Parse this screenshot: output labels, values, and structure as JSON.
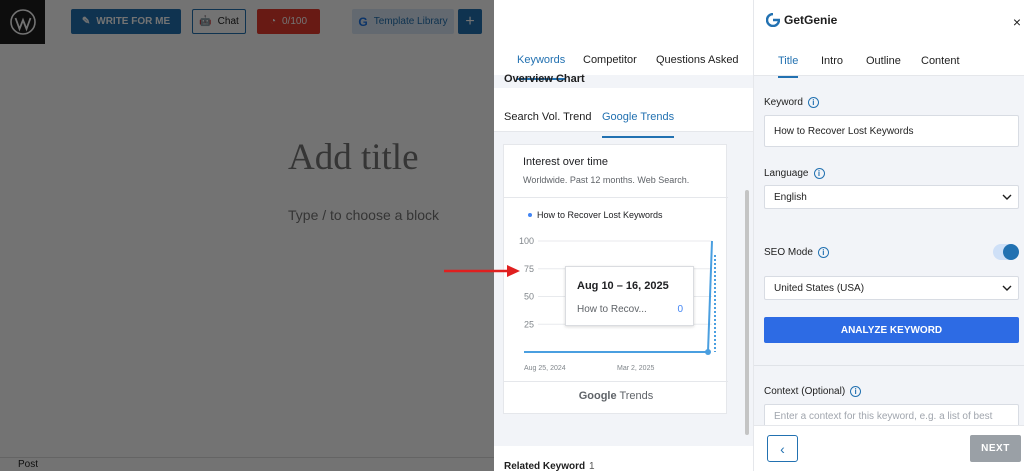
{
  "toolbar": {
    "write_label": "WRITE FOR ME",
    "chat_label": "Chat",
    "usage_label": "0/100",
    "template_label": "Template Library",
    "plus_label": "+"
  },
  "editor": {
    "title_placeholder": "Add title",
    "block_placeholder": "Type / to choose a block",
    "footer_label": "Post"
  },
  "middle": {
    "tabs": [
      {
        "label": "Keywords",
        "active": true
      },
      {
        "label": "Competitor",
        "active": false
      },
      {
        "label": "Questions Asked",
        "active": false
      }
    ],
    "overview_label": "Overview Chart",
    "sub_tabs": [
      {
        "label": "Search Vol. Trend",
        "active": false
      },
      {
        "label": "Google Trends",
        "active": true
      }
    ],
    "trends": {
      "title": "Interest over time",
      "subtitle": "Worldwide. Past 12 months. Web Search.",
      "legend": "How to Recover Lost Keywords",
      "footer_google": "Google",
      "footer_trends": "Trends",
      "tooltip": {
        "date": "Aug 10 – 16, 2025",
        "label": "How to Recov...",
        "value": "0"
      }
    },
    "related_label": "Related Keyword",
    "related_count": "1"
  },
  "chart_data": {
    "type": "line",
    "title": "Interest over time",
    "subtitle": "Worldwide. Past 12 months. Web Search.",
    "x_tick_labels": [
      "Aug 25, 2024",
      "Mar 2, 2025"
    ],
    "y_ticks": [
      25,
      50,
      75,
      100
    ],
    "ylim": [
      0,
      100
    ],
    "series": [
      {
        "name": "How to Recover Lost Keywords",
        "x": [
          "Aug 25, 2024",
          "Sep 2024",
          "Oct 2024",
          "Nov 2024",
          "Dec 2024",
          "Jan 2025",
          "Feb 2025",
          "Mar 2, 2025",
          "Apr 2025",
          "May 2025",
          "Jun 2025",
          "Jul 2025",
          "Aug 10, 2025",
          "Aug 17, 2025"
        ],
        "values": [
          0,
          0,
          0,
          0,
          0,
          0,
          0,
          0,
          0,
          0,
          0,
          0,
          0,
          100
        ]
      }
    ]
  },
  "right": {
    "brand": "GetGenie",
    "close": "×",
    "tabs": [
      {
        "label": "Title",
        "active": true
      },
      {
        "label": "Intro",
        "active": false
      },
      {
        "label": "Outline",
        "active": false
      },
      {
        "label": "Content",
        "active": false
      }
    ],
    "keyword_label": "Keyword",
    "keyword_value": "How to Recover Lost Keywords",
    "language_label": "Language",
    "language_value": "English",
    "seo_mode_label": "SEO Mode",
    "country_value": "United States (USA)",
    "analyze_label": "ANALYZE KEYWORD",
    "context_label": "Context (Optional)",
    "context_placeholder": "Enter a context for this keyword, e.g. a list of best",
    "next_label": "NEXT",
    "back_label": "‹"
  },
  "colors": {
    "accent": "#2271b1",
    "danger": "#e63b2e",
    "line": "#4a9fe0"
  }
}
